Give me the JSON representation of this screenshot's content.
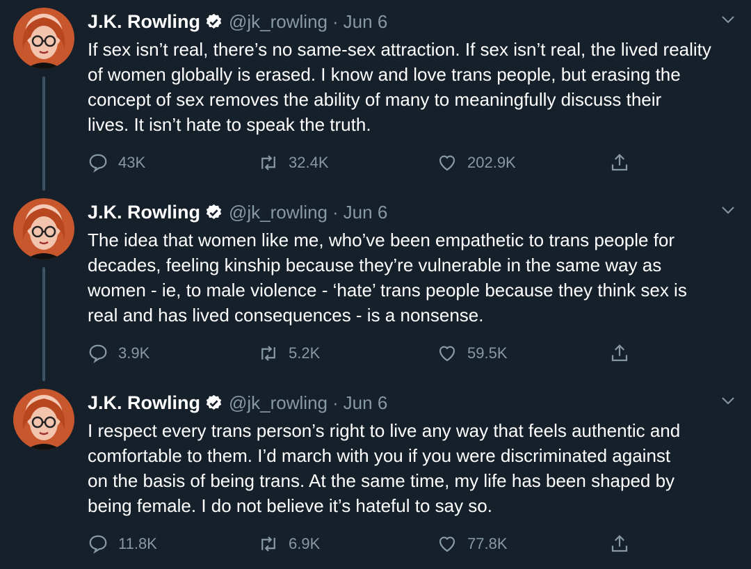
{
  "tweets": [
    {
      "name": "J.K. Rowling",
      "handle": "@jk_rowling",
      "separator": "·",
      "date": "Jun 6",
      "lines": [
        "If sex isn’t real, there’s no same-sex attraction. If sex isn’t real, the lived reality",
        "of women globally is erased. I know and love trans people, but erasing the",
        "concept of sex removes the ability of many to meaningfully discuss their",
        "lives. It isn’t hate to speak the truth."
      ],
      "replies": "43K",
      "retweets": "32.4K",
      "likes": "202.9K"
    },
    {
      "name": "J.K. Rowling",
      "handle": "@jk_rowling",
      "separator": "·",
      "date": "Jun 6",
      "lines": [
        "The idea that women like me, who’ve been empathetic to trans people for",
        "decades, feeling kinship because they’re vulnerable in the same way as",
        "women - ie, to male violence - ‘hate’ trans people because they think sex is",
        "real and has lived consequences - is a nonsense."
      ],
      "replies": "3.9K",
      "retweets": "5.2K",
      "likes": "59.5K"
    },
    {
      "name": "J.K. Rowling",
      "handle": "@jk_rowling",
      "separator": "·",
      "date": "Jun 6",
      "lines": [
        "I respect every trans person’s right to live any way that feels authentic and",
        "comfortable to them. I’d march with you if you were discriminated against",
        "on the basis of being trans. At the same time, my life has been shaped by",
        "being female. I do not believe it’s hateful to say so."
      ],
      "replies": "11.8K",
      "retweets": "6.9K",
      "likes": "77.8K"
    }
  ],
  "icons": {
    "reply": "reply-icon",
    "retweet": "retweet-icon",
    "like": "heart-icon",
    "share": "share-icon",
    "verified": "verified-badge-icon",
    "more": "chevron-down-icon"
  },
  "colors": {
    "background": "#15202b",
    "text": "#ffffff",
    "secondary": "#8899a6",
    "thread_line": "#3d5466"
  }
}
